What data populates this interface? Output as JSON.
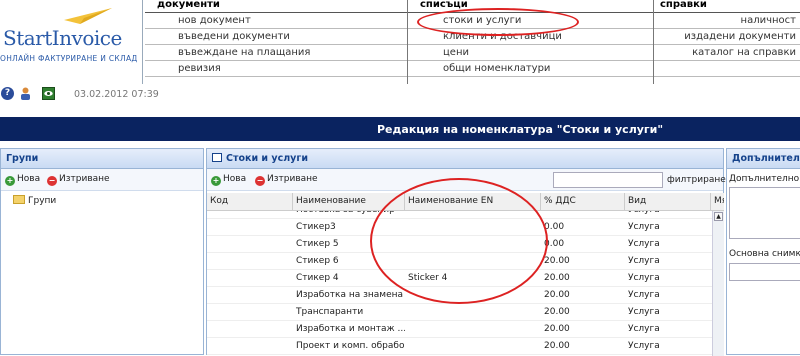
{
  "logo": {
    "name": "StartInvoice",
    "tagline": "ОНЛАЙН ФАКТУРИРАНЕ И СКЛАД"
  },
  "menu": {
    "documents": {
      "header": "документи",
      "items": [
        "нов документ",
        "въведени документи",
        "въвеждане на плащания",
        "ревизия"
      ]
    },
    "lists": {
      "header": "списъци",
      "items": [
        "стоки и услуги",
        "клиенти и доставчици",
        "цени",
        "общи номенклатури"
      ]
    },
    "references": {
      "header": "справки",
      "items": [
        "наличност",
        "издадени документи",
        "каталог на справки",
        ""
      ]
    }
  },
  "status": {
    "datetime": "03.02.2012 07:39",
    "help_icon": "help-icon",
    "user_icon": "user-icon",
    "eye_icon": "eye-icon"
  },
  "title": "Редакция на номенклатура \"Стоки и услуги\"",
  "groups_panel": {
    "title": "Групи",
    "new_label": "Нова",
    "delete_label": "Изтриване",
    "tree": [
      "Групи"
    ]
  },
  "goods_panel": {
    "title": "Стоки и услуги",
    "new_label": "Нова",
    "delete_label": "Изтриване",
    "filter_label": "филтриране",
    "filter_value": "",
    "columns": [
      "Код",
      "Наименование",
      "Наименование EN",
      "% ДДС",
      "Вид",
      "Мя"
    ],
    "rows": [
      {
        "code": "",
        "name": "Поставка за сувенир",
        "name_en": "",
        "vat": "",
        "type": "Услуга"
      },
      {
        "code": "",
        "name": "Стикер3",
        "name_en": "",
        "vat": "0.00",
        "type": "Услуга"
      },
      {
        "code": "",
        "name": "Стикер 5",
        "name_en": "",
        "vat": "0.00",
        "type": "Услуга"
      },
      {
        "code": "",
        "name": "Стикер 6",
        "name_en": "",
        "vat": "20.00",
        "type": "Услуга"
      },
      {
        "code": "",
        "name": "Стикер 4",
        "name_en": "Sticker 4",
        "vat": "20.00",
        "type": "Услуга"
      },
      {
        "code": "",
        "name": "Изработка на знамена",
        "name_en": "",
        "vat": "20.00",
        "type": "Услуга"
      },
      {
        "code": "",
        "name": "Транспаранти",
        "name_en": "",
        "vat": "20.00",
        "type": "Услуга"
      },
      {
        "code": "",
        "name": "Изработка и монтаж ...",
        "name_en": "",
        "vat": "20.00",
        "type": "Услуга"
      },
      {
        "code": "",
        "name": "Проект и комп. обрабо...",
        "name_en": "",
        "vat": "20.00",
        "type": "Услуга"
      }
    ]
  },
  "extra_panel": {
    "title": "Допълнителни",
    "field1_label": "Допълнително",
    "field2_label": "Основна снимка"
  },
  "colors": {
    "title_bar": "#0a2360",
    "panel_header": "#15428b",
    "highlight": "#dd2222"
  }
}
